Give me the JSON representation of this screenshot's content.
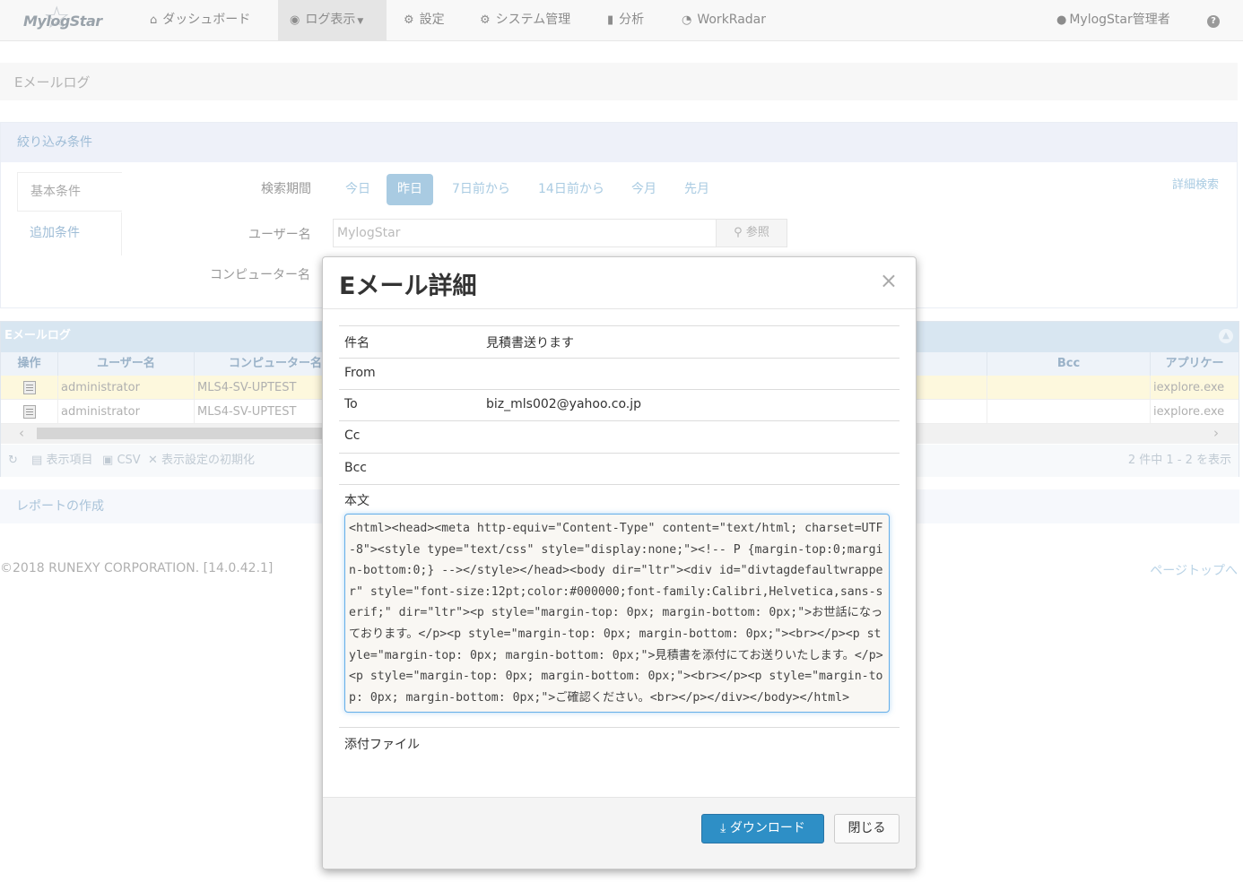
{
  "nav": {
    "logo": "MylogStar",
    "dashboard": "ダッシュボード",
    "log_view": "ログ表示",
    "settings": "設定",
    "system_admin": "システム管理",
    "analysis": "分析",
    "workradar": "WorkRadar",
    "user": "MylogStar管理者",
    "help": "?"
  },
  "page": {
    "title": "Eメールログ"
  },
  "filter": {
    "header": "絞り込み条件",
    "tab_basic": "基本条件",
    "tab_additional": "追加条件",
    "period_label": "検索期間",
    "periods": [
      "今日",
      "昨日",
      "7日前から",
      "14日前から",
      "今月",
      "先月"
    ],
    "period_selected": "昨日",
    "advanced_search": "詳細検索",
    "user_label": "ユーザー名",
    "user_value": "MylogStar",
    "ref_button": "参照",
    "computer_label": "コンピューター名"
  },
  "grid": {
    "title": "Eメールログ",
    "columns": {
      "op": "操作",
      "user": "ユーザー名",
      "computer": "コンピューター名",
      "bcc": "Bcc",
      "app": "アプリケー"
    },
    "rows": [
      {
        "user": "administrator",
        "computer": "MLS4-SV-UPTEST",
        "app": "iexplore.exe"
      },
      {
        "user": "administrator",
        "computer": "MLS4-SV-UPTEST",
        "app": "iexplore.exe"
      }
    ],
    "pager": {
      "display_items": "表示項目",
      "csv": "CSV",
      "reset": "表示設定の初期化",
      "summary": "2 件中 1 - 2 を表示"
    }
  },
  "report": {
    "label": "レポートの作成"
  },
  "footer": {
    "copyright": "©2018 RUNEXY CORPORATION. [14.0.42.1]",
    "page_top": "ページトップへ"
  },
  "modal": {
    "title": "Eメール詳細",
    "close_symbol": "×",
    "subject_label": "件名",
    "subject_value": "見積書送ります",
    "from_label": "From",
    "from_value": "",
    "to_label": "To",
    "to_value": "biz_mls002@yahoo.co.jp",
    "cc_label": "Cc",
    "cc_value": "",
    "bcc_label": "Bcc",
    "bcc_value": "",
    "body_label": "本文",
    "body_value": "<html><head><meta http-equiv=\"Content-Type\" content=\"text/html; charset=UTF-8\"><style type=\"text/css\" style=\"display:none;\"><!-- P {margin-top:0;margin-bottom:0;} --></style></head><body dir=\"ltr\"><div id=\"divtagdefaultwrapper\" style=\"font-size:12pt;color:#000000;font-family:Calibri,Helvetica,sans-serif;\" dir=\"ltr\"><p style=\"margin-top: 0px; margin-bottom: 0px;\">お世話になっております。</p><p style=\"margin-top: 0px; margin-bottom: 0px;\"><br></p><p style=\"margin-top: 0px; margin-bottom: 0px;\">見積書を添付にてお送りいたします。</p><p style=\"margin-top: 0px; margin-bottom: 0px;\"><br></p><p style=\"margin-top: 0px; margin-bottom: 0px;\">ご確認ください。<br></p></div></body></html>",
    "attachment_label": "添付ファイル",
    "download_button": "ダウンロード",
    "close_button": "閉じる"
  }
}
